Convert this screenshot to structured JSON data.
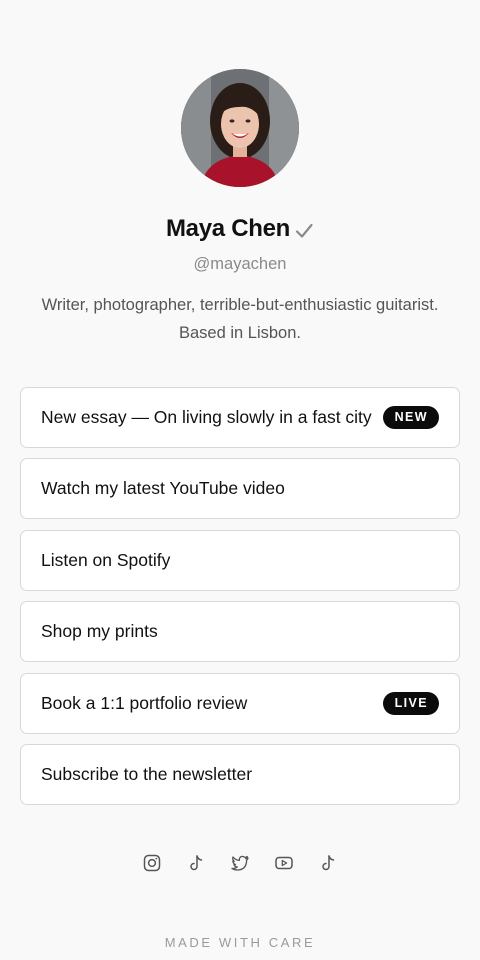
{
  "profile": {
    "name": "Maya Chen",
    "verified_icon": "checkmark-icon",
    "handle": "@mayachen",
    "bio": "Writer, photographer, terrible-but-enthusiastic guitarist. Based in Lisbon."
  },
  "links": [
    {
      "label": "New essay — On living slowly in a fast city",
      "badge": "NEW"
    },
    {
      "label": "Watch my latest YouTube video"
    },
    {
      "label": "Listen on Spotify"
    },
    {
      "label": "Shop my prints"
    },
    {
      "label": "Book a 1:1 portfolio review",
      "badge": "LIVE"
    },
    {
      "label": "Subscribe to the newsletter"
    }
  ],
  "socials": [
    "instagram-icon",
    "tiktok-icon",
    "twitter-icon",
    "youtube-icon",
    "tiktok-icon"
  ],
  "footer": "MADE WITH CARE",
  "colors": {
    "background": "#f9f9f9",
    "card_border": "#d8d8d8",
    "badge_background": "#0b0b0b",
    "muted_text": "#8a8a8a"
  }
}
